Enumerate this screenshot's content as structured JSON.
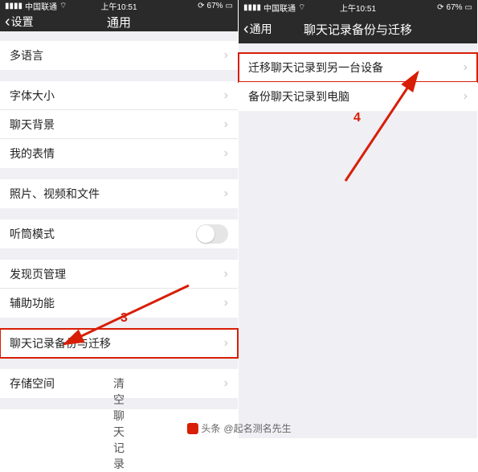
{
  "statusbar": {
    "carrier": "中国联通",
    "time": "上午10:51",
    "battery": "67%"
  },
  "left": {
    "back": "设置",
    "title": "通用",
    "items": {
      "multilang": "多语言",
      "fontsize": "字体大小",
      "chatbg": "聊天背景",
      "stickers": "我的表情",
      "media": "照片、视频和文件",
      "earpiece": "听筒模式",
      "discover": "发现页管理",
      "accessibility": "辅助功能",
      "backup": "聊天记录备份与迁移",
      "storage": "存储空间",
      "clear": "清空聊天记录"
    }
  },
  "right": {
    "back": "通用",
    "title": "聊天记录备份与迁移",
    "items": {
      "migrate": "迁移聊天记录到另一台设备",
      "tocomputer": "备份聊天记录到电脑"
    }
  },
  "annotations": {
    "n3": "3",
    "n4": "4"
  },
  "footer": {
    "prefix": "头条",
    "author": "@起名测名先生"
  }
}
